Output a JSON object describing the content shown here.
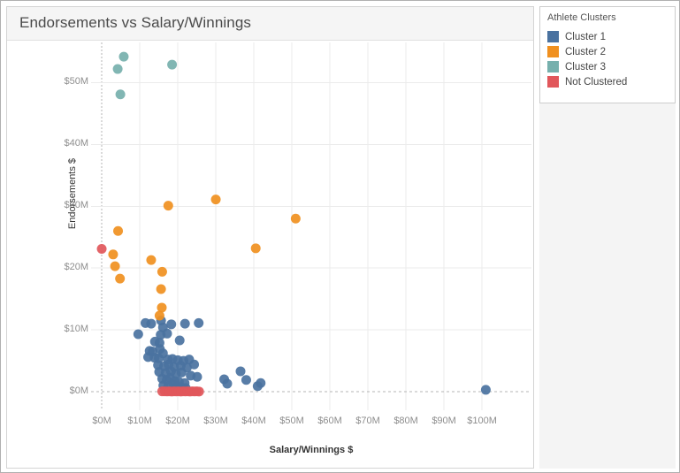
{
  "window": {
    "background": "#ffffff",
    "border_color": "#b0b0b0"
  },
  "title": "Endorsements vs Salary/Winnings",
  "legend": {
    "title": "Athlete Clusters",
    "items": [
      {
        "label": "Cluster 1",
        "color": "#4a72a0"
      },
      {
        "label": "Cluster 2",
        "color": "#f0901f"
      },
      {
        "label": "Cluster 3",
        "color": "#76b0ad"
      },
      {
        "label": "Not Clustered",
        "color": "#e1575b"
      }
    ]
  },
  "chart_data": {
    "type": "scatter",
    "title": "Endorsements vs Salary/Winnings",
    "xlabel": "Salary/Winnings $",
    "ylabel": "Endorsements $",
    "xlim": [
      -2.8,
      113.0
    ],
    "ylim": [
      -3.0,
      56.5
    ],
    "x_ticks": [
      0,
      10,
      20,
      30,
      40,
      50,
      60,
      70,
      80,
      90,
      100
    ],
    "x_tick_labels": [
      "$0M",
      "$10M",
      "$20M",
      "$30M",
      "$40M",
      "$50M",
      "$60M",
      "$70M",
      "$80M",
      "$90M",
      "$100M"
    ],
    "y_ticks": [
      0,
      10,
      20,
      30,
      40,
      50
    ],
    "y_tick_labels": [
      "$0M",
      "$10M",
      "$20M",
      "$30M",
      "$40M",
      "$50M"
    ],
    "grid": true,
    "grid_color": "#ebebeb",
    "zero_line_style": "dashed",
    "zero_line_color": "#b5b5b5",
    "legend_position": "right-outside",
    "units": "millions USD",
    "marker_radius": 5.5,
    "series": [
      {
        "name": "Cluster 1",
        "color": "#4a72a0",
        "points": [
          [
            11.5,
            11.1
          ],
          [
            13.0,
            11.0
          ],
          [
            15.6,
            11.5
          ],
          [
            16.1,
            10.4
          ],
          [
            18.3,
            10.9
          ],
          [
            21.9,
            11.0
          ],
          [
            25.5,
            11.1
          ],
          [
            9.6,
            9.3
          ],
          [
            15.5,
            9.2
          ],
          [
            17.2,
            9.4
          ],
          [
            14.0,
            8.1
          ],
          [
            15.2,
            7.9
          ],
          [
            20.5,
            8.3
          ],
          [
            12.6,
            6.6
          ],
          [
            13.4,
            6.5
          ],
          [
            15.3,
            6.9
          ],
          [
            16.1,
            6.2
          ],
          [
            12.2,
            5.6
          ],
          [
            13.9,
            5.5
          ],
          [
            15.0,
            5.4
          ],
          [
            17.4,
            5.2
          ],
          [
            18.6,
            5.3
          ],
          [
            20.0,
            5.1
          ],
          [
            21.5,
            5.0
          ],
          [
            23.0,
            5.2
          ],
          [
            14.8,
            4.3
          ],
          [
            16.4,
            4.1
          ],
          [
            17.6,
            4.4
          ],
          [
            19.0,
            4.0
          ],
          [
            20.8,
            4.2
          ],
          [
            22.4,
            3.9
          ],
          [
            24.3,
            4.4
          ],
          [
            15.1,
            3.2
          ],
          [
            16.8,
            3.0
          ],
          [
            18.2,
            3.3
          ],
          [
            19.5,
            2.9
          ],
          [
            21.0,
            3.1
          ],
          [
            23.4,
            2.6
          ],
          [
            25.1,
            2.4
          ],
          [
            15.9,
            2.1
          ],
          [
            17.1,
            1.9
          ],
          [
            18.0,
            2.2
          ],
          [
            19.2,
            1.7
          ],
          [
            20.3,
            1.6
          ],
          [
            21.8,
            1.4
          ],
          [
            16.2,
            1.0
          ],
          [
            17.5,
            0.9
          ],
          [
            18.8,
            1.1
          ],
          [
            19.9,
            0.8
          ],
          [
            20.9,
            0.7
          ],
          [
            22.1,
            0.6
          ],
          [
            32.2,
            2.0
          ],
          [
            33.0,
            1.3
          ],
          [
            36.5,
            3.3
          ],
          [
            38.0,
            1.9
          ],
          [
            41.0,
            0.9
          ],
          [
            41.8,
            1.4
          ],
          [
            101.0,
            0.3
          ]
        ]
      },
      {
        "name": "Cluster 2",
        "color": "#f0901f",
        "points": [
          [
            17.5,
            30.1
          ],
          [
            30.0,
            31.1
          ],
          [
            51.0,
            28.0
          ],
          [
            40.5,
            23.2
          ],
          [
            4.3,
            26.0
          ],
          [
            3.0,
            22.2
          ],
          [
            3.5,
            20.3
          ],
          [
            4.8,
            18.3
          ],
          [
            13.0,
            21.3
          ],
          [
            15.9,
            19.4
          ],
          [
            15.6,
            16.6
          ],
          [
            15.8,
            13.6
          ],
          [
            15.2,
            12.3
          ]
        ]
      },
      {
        "name": "Cluster 3",
        "color": "#76b0ad",
        "points": [
          [
            5.8,
            54.2
          ],
          [
            4.2,
            52.2
          ],
          [
            18.5,
            52.9
          ],
          [
            4.9,
            48.1
          ]
        ]
      },
      {
        "name": "Not Clustered",
        "color": "#e1575b",
        "points": [
          [
            0.0,
            23.1
          ],
          [
            15.9,
            0.05
          ],
          [
            16.6,
            0.05
          ],
          [
            17.2,
            0.04
          ],
          [
            17.8,
            0.05
          ],
          [
            18.4,
            0.03
          ],
          [
            19.0,
            0.05
          ],
          [
            19.6,
            0.04
          ],
          [
            20.2,
            0.05
          ],
          [
            20.8,
            0.03
          ],
          [
            21.4,
            0.05
          ],
          [
            22.0,
            0.04
          ],
          [
            22.6,
            0.05
          ],
          [
            23.2,
            0.03
          ],
          [
            23.8,
            0.05
          ],
          [
            24.4,
            0.04
          ],
          [
            25.0,
            0.05
          ],
          [
            25.6,
            0.03
          ]
        ]
      }
    ]
  }
}
